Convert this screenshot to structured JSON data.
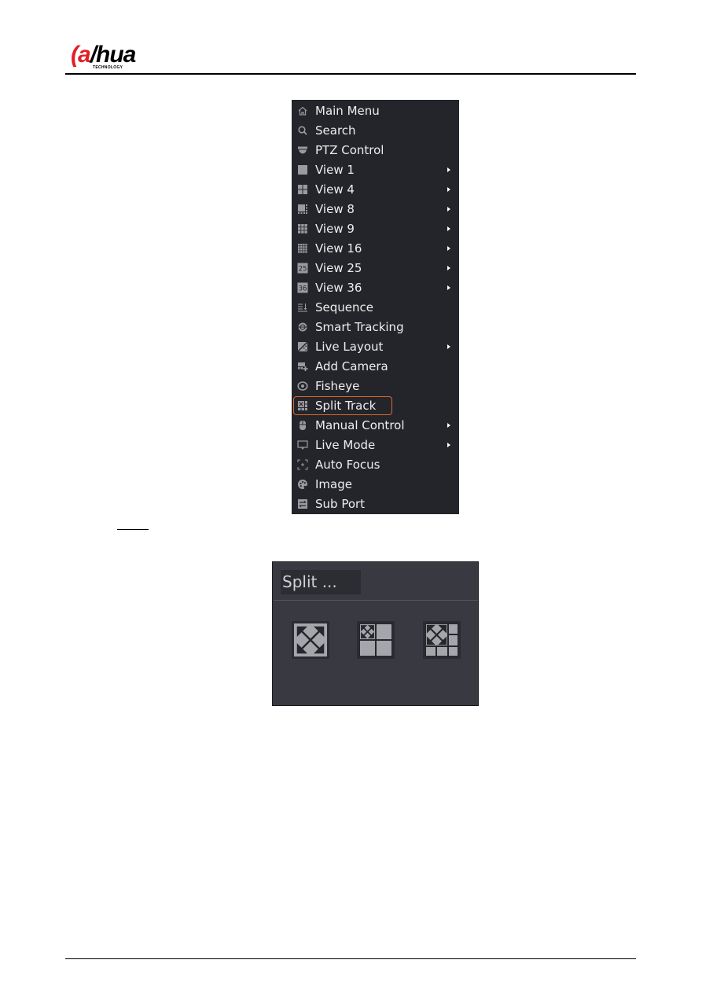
{
  "header": {
    "brand_logo": "alhua",
    "brand_tagline": "TECHNOLOGY"
  },
  "menu": {
    "items": [
      {
        "label": "Main Menu",
        "icon": "home-icon",
        "submenu": false
      },
      {
        "label": "Search",
        "icon": "search-icon",
        "submenu": false
      },
      {
        "label": "PTZ Control",
        "icon": "ptz-camera-icon",
        "submenu": false
      },
      {
        "label": "View 1",
        "icon": "view1-icon",
        "submenu": true
      },
      {
        "label": "View 4",
        "icon": "view4-icon",
        "submenu": true
      },
      {
        "label": "View 8",
        "icon": "view8-icon",
        "submenu": true
      },
      {
        "label": "View 9",
        "icon": "view9-icon",
        "submenu": true
      },
      {
        "label": "View 16",
        "icon": "view16-icon",
        "submenu": true
      },
      {
        "label": "View 25",
        "icon": "view25-icon",
        "submenu": true,
        "icon_text": "25"
      },
      {
        "label": "View 36",
        "icon": "view36-icon",
        "submenu": true,
        "icon_text": "36"
      },
      {
        "label": "Sequence",
        "icon": "sequence-icon",
        "submenu": false
      },
      {
        "label": "Smart Tracking",
        "icon": "smart-tracking-icon",
        "submenu": false
      },
      {
        "label": "Live Layout",
        "icon": "live-layout-icon",
        "submenu": true
      },
      {
        "label": "Add Camera",
        "icon": "add-camera-icon",
        "submenu": false
      },
      {
        "label": "Fisheye",
        "icon": "fisheye-icon",
        "submenu": false
      },
      {
        "label": "Split Track",
        "icon": "split-track-icon",
        "submenu": false,
        "highlighted": true
      },
      {
        "label": "Manual Control",
        "icon": "manual-control-icon",
        "submenu": true
      },
      {
        "label": "Live Mode",
        "icon": "live-mode-icon",
        "submenu": true
      },
      {
        "label": "Auto Focus",
        "icon": "auto-focus-icon",
        "submenu": false
      },
      {
        "label": "Image",
        "icon": "image-icon",
        "submenu": false
      },
      {
        "label": "Sub Port",
        "icon": "sub-port-icon",
        "submenu": false
      }
    ],
    "highlight_color": "#d9692a"
  },
  "split_panel": {
    "title": "Split ...",
    "options": [
      {
        "name": "split-1-fullscreen"
      },
      {
        "name": "split-1-plus-3"
      },
      {
        "name": "split-1-plus-5"
      }
    ]
  }
}
